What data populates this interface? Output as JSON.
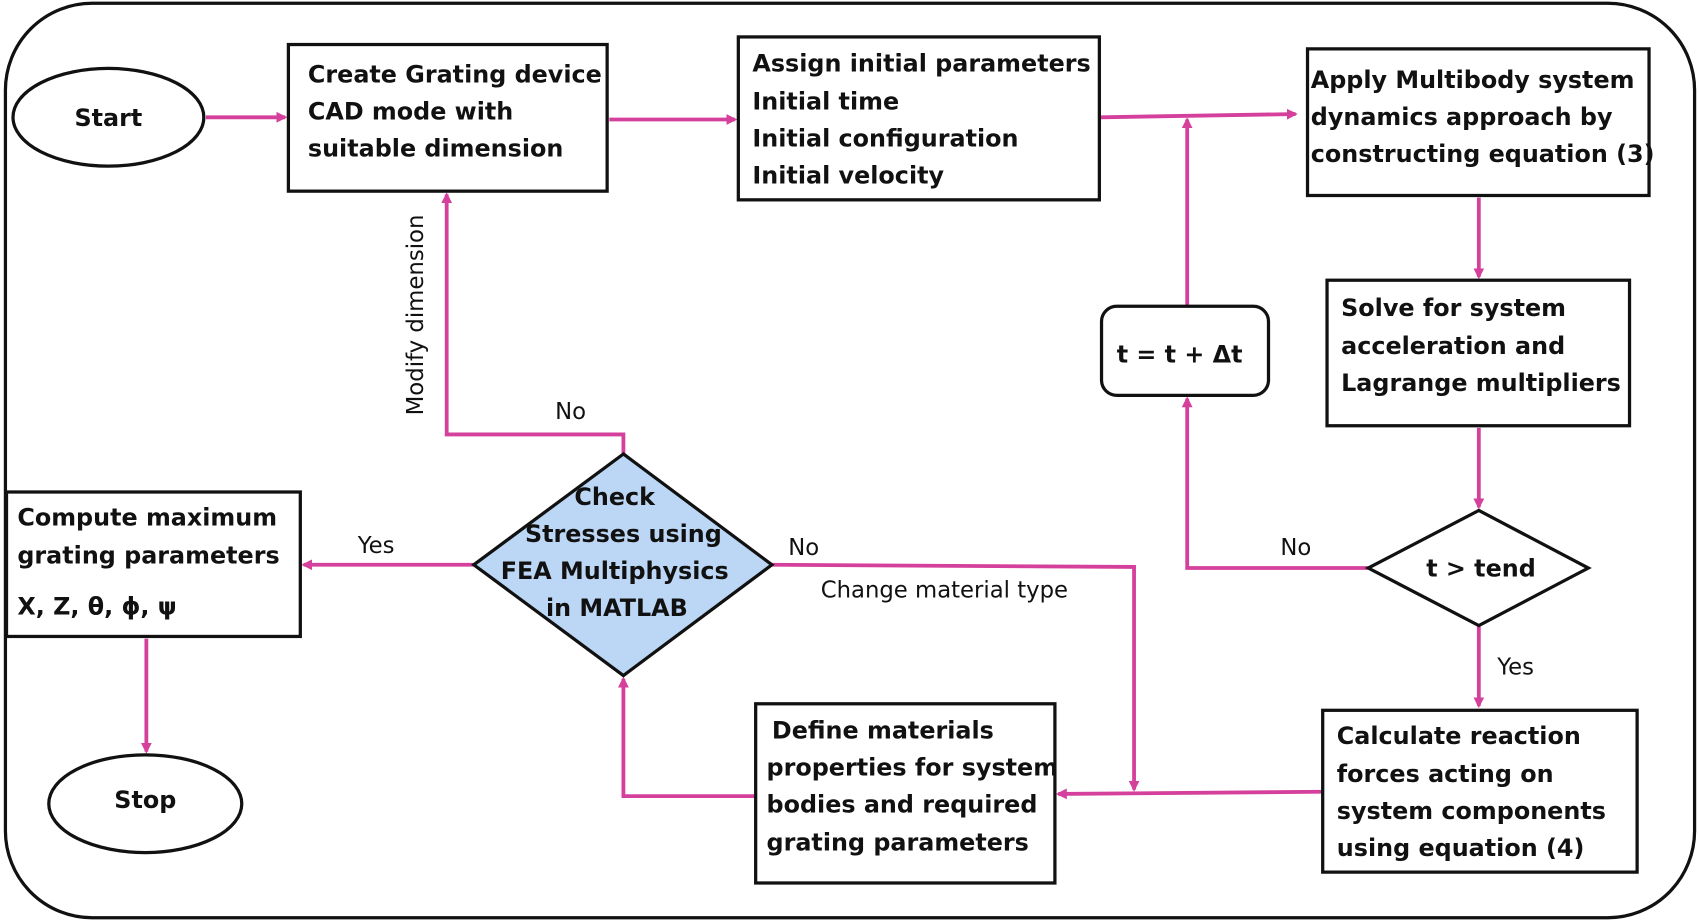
{
  "colors": {
    "arrow": "#d4409b",
    "decision_fill": "#bcd7f5",
    "stroke": "#111111"
  },
  "nodes": {
    "start": "Start",
    "stop": "Stop",
    "create_cad": [
      "Create Grating device",
      "CAD mode with",
      "suitable dimension"
    ],
    "assign_params": [
      "Assign initial parameters",
      "Initial time",
      "Initial configuration",
      "Initial velocity"
    ],
    "apply_multibody": [
      "Apply Multibody system",
      "dynamics approach by",
      "constructing equation (3)"
    ],
    "solve": [
      "Solve for system",
      "acceleration and",
      "Lagrange multipliers"
    ],
    "time_check": "t > tend",
    "time_step": "t = t +  Δt",
    "calc_reaction": [
      "Calculate reaction",
      "forces acting on",
      "system components",
      "using equation (4)"
    ],
    "define_materials": [
      "Define materials",
      "properties for system",
      "bodies and required",
      "grating parameters"
    ],
    "check_stresses": [
      "Check",
      "Stresses using",
      "FEA Multiphysics",
      "in MATLAB"
    ],
    "compute_max": [
      "Compute maximum",
      "grating parameters",
      "X, Z, θ, ϕ, ψ"
    ]
  },
  "edge_labels": {
    "modify_dimension": "Modify dimension",
    "check_no_top": "No",
    "check_yes": "Yes",
    "check_no_right": "No",
    "change_material": "Change material type",
    "time_no": "No",
    "time_yes": "Yes"
  }
}
